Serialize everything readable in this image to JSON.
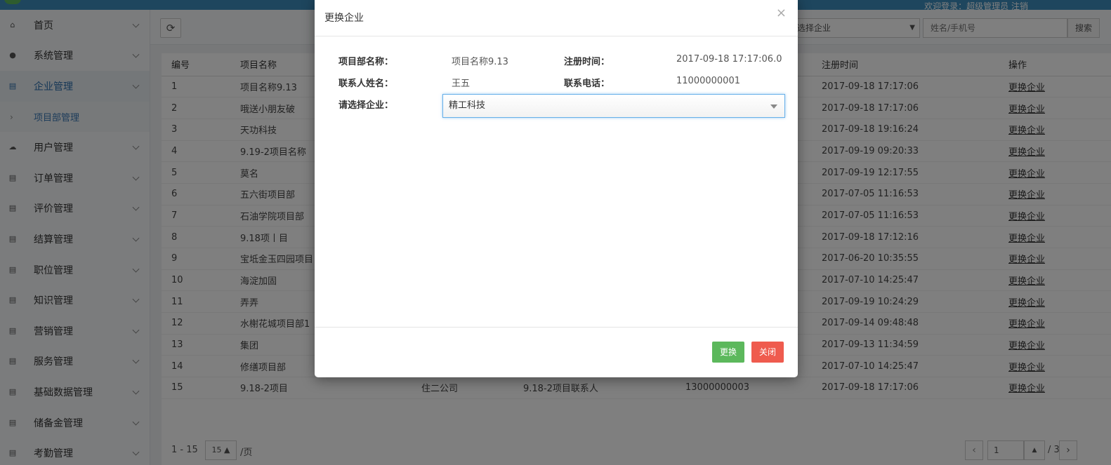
{
  "header": {
    "welcome": "欢迎登录：超级管理员 注销"
  },
  "sidebar": {
    "items": [
      {
        "label": "首页",
        "icon": "home-icon"
      },
      {
        "label": "系统管理",
        "icon": "user-icon"
      },
      {
        "label": "企业管理",
        "icon": "file-icon",
        "active": true
      },
      {
        "label": "项目部管理",
        "sub": true
      },
      {
        "label": "用户管理",
        "icon": "cloud-icon"
      },
      {
        "label": "订单管理",
        "icon": "file-icon"
      },
      {
        "label": "评价管理",
        "icon": "file-icon"
      },
      {
        "label": "结算管理",
        "icon": "file-icon"
      },
      {
        "label": "职位管理",
        "icon": "file-icon"
      },
      {
        "label": "知识管理",
        "icon": "file-icon"
      },
      {
        "label": "营销管理",
        "icon": "file-icon"
      },
      {
        "label": "服务管理",
        "icon": "file-icon"
      },
      {
        "label": "基础数据管理",
        "icon": "file-icon"
      },
      {
        "label": "储备金管理",
        "icon": "file-icon"
      },
      {
        "label": "考勤管理",
        "icon": "file-icon"
      }
    ]
  },
  "toolbar": {
    "company_select_value": "请选择企业",
    "search_placeholder": "姓名/手机号",
    "search_label": "搜索"
  },
  "table": {
    "headers": [
      "编号",
      "项目名称",
      "",
      "",
      "",
      "注册时间",
      "操作"
    ],
    "rows": [
      {
        "id": "1",
        "name": "项目名称9.13",
        "company": "",
        "contact": "",
        "phone": "",
        "time": "2017-09-18 17:17:06",
        "op": "更换企业"
      },
      {
        "id": "2",
        "name": "哦送小朋友破",
        "company": "",
        "contact": "",
        "phone": "",
        "time": "2017-09-18 17:17:06",
        "op": "更换企业"
      },
      {
        "id": "3",
        "name": "天功科技",
        "company": "",
        "contact": "",
        "phone": "",
        "time": "2017-09-18 19:16:24",
        "op": "更换企业"
      },
      {
        "id": "4",
        "name": "9.19-2项目名称",
        "company": "",
        "contact": "",
        "phone": "",
        "time": "2017-09-19 09:20:33",
        "op": "更换企业"
      },
      {
        "id": "5",
        "name": "莫名",
        "company": "",
        "contact": "",
        "phone": "",
        "time": "2017-09-19 12:17:55",
        "op": "更换企业"
      },
      {
        "id": "6",
        "name": "五六街项目部",
        "company": "",
        "contact": "",
        "phone": "",
        "time": "2017-07-05 11:16:53",
        "op": "更换企业"
      },
      {
        "id": "7",
        "name": "石油学院项目部",
        "company": "",
        "contact": "",
        "phone": "",
        "time": "2017-07-05 11:16:53",
        "op": "更换企业"
      },
      {
        "id": "8",
        "name": "9.18项丨目",
        "company": "",
        "contact": "",
        "phone": "",
        "time": "2017-09-18 17:12:16",
        "op": "更换企业"
      },
      {
        "id": "9",
        "name": "宝坻金玉四园项目",
        "company": "",
        "contact": "",
        "phone": "",
        "time": "2017-06-20 10:35:55",
        "op": "更换企业"
      },
      {
        "id": "10",
        "name": "海淀加固",
        "company": "",
        "contact": "",
        "phone": "",
        "time": "2017-07-10 14:25:47",
        "op": "更换企业"
      },
      {
        "id": "11",
        "name": "弄弄",
        "company": "",
        "contact": "",
        "phone": "",
        "time": "2017-09-19 10:24:29",
        "op": "更换企业"
      },
      {
        "id": "12",
        "name": "水榭花城项目部1",
        "company": "",
        "contact": "",
        "phone": "",
        "time": "2017-09-14 09:48:48",
        "op": "更换企业"
      },
      {
        "id": "13",
        "name": "集团",
        "company": "",
        "contact": "",
        "phone": "",
        "time": "2017-09-13 11:34:59",
        "op": "更换企业"
      },
      {
        "id": "14",
        "name": "修缮项目部",
        "company": "",
        "contact": "",
        "phone": "",
        "time": "2017-07-10 14:25:47",
        "op": "更换企业"
      },
      {
        "id": "15",
        "name": "9.18-2项目",
        "company": "住二公司",
        "contact": "9.18-2项目联系人",
        "phone": "13000000003",
        "time": "2017-09-18 17:17:06",
        "op": "更换企业"
      }
    ]
  },
  "pager": {
    "range": "1 - 15",
    "page_size": "15",
    "per_page_unit": "/页",
    "page_value": "1",
    "total": "/ 3"
  },
  "modal": {
    "title": "更换企业",
    "close_symbol": "×",
    "project_label": "项目部名称：",
    "project_value": "项目名称9.13",
    "reg_time_label": "注册时间：",
    "reg_time_value": "2017-09-18 17:17:06.0",
    "contact_label": "联系人姓名：",
    "contact_value": "王五",
    "phone_label": "联系电话：",
    "phone_value": "11000000001",
    "company_label": "请选择企业：",
    "company_value": "精工科技",
    "change_label": "更换",
    "close_label": "关闭"
  },
  "colors": {
    "accent": "#3c8dbc",
    "confirm": "#5cb85c",
    "danger": "#ef5b4e"
  }
}
